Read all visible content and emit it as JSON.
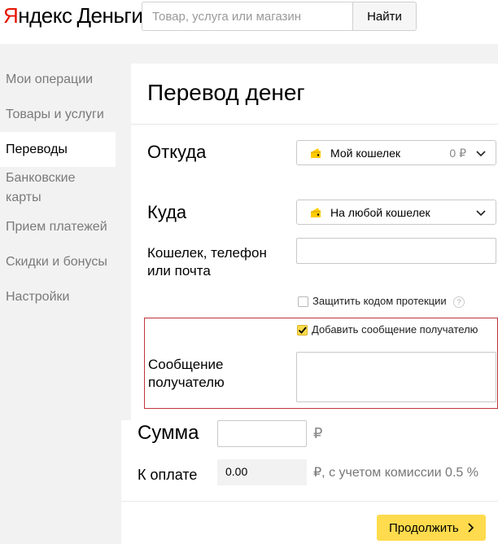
{
  "header": {
    "logo_y": "Я",
    "logo_rest": "ндекс",
    "logo_money": "Деньги",
    "search_placeholder": "Товар, услуга или магазин",
    "search_button": "Найти"
  },
  "sidebar": {
    "items": [
      {
        "label": "Мои операции"
      },
      {
        "label": "Товары и услуги"
      },
      {
        "label": "Переводы",
        "active": true
      },
      {
        "label": "Банковские карты"
      },
      {
        "label": "Прием платежей"
      },
      {
        "label": "Скидки и бонусы"
      },
      {
        "label": "Настройки"
      }
    ]
  },
  "main": {
    "title": "Перевод денег",
    "from": {
      "label": "Откуда",
      "wallet": "Мой кошелек",
      "balance": "0 ₽"
    },
    "to": {
      "label": "Куда",
      "wallet": "На любой кошелек"
    },
    "recipient_label": "Кошелек, телефон или почта",
    "recipient_value": "",
    "protect_code": {
      "label": "Защитить кодом протекции",
      "checked": false
    },
    "add_message": {
      "label": "Добавить сообщение получателю",
      "checked": true
    },
    "message_label": "Сообщение получателю",
    "message_value": "",
    "sum": {
      "label": "Сумма",
      "value": "",
      "currency": "₽"
    },
    "pay": {
      "label": "К оплате",
      "value": "0.00",
      "note": "₽, с учетом комиссии 0.5 %"
    },
    "continue_button": "Продолжить"
  },
  "colors": {
    "accent_yellow": "#ffdb4d",
    "logo_red": "#e61400",
    "highlight_border": "#c0343c"
  },
  "icons": {
    "wallet": "wallet-icon",
    "chevron": "chevron-down-icon",
    "help": "help-icon",
    "arrow": "chevron-right-icon"
  }
}
